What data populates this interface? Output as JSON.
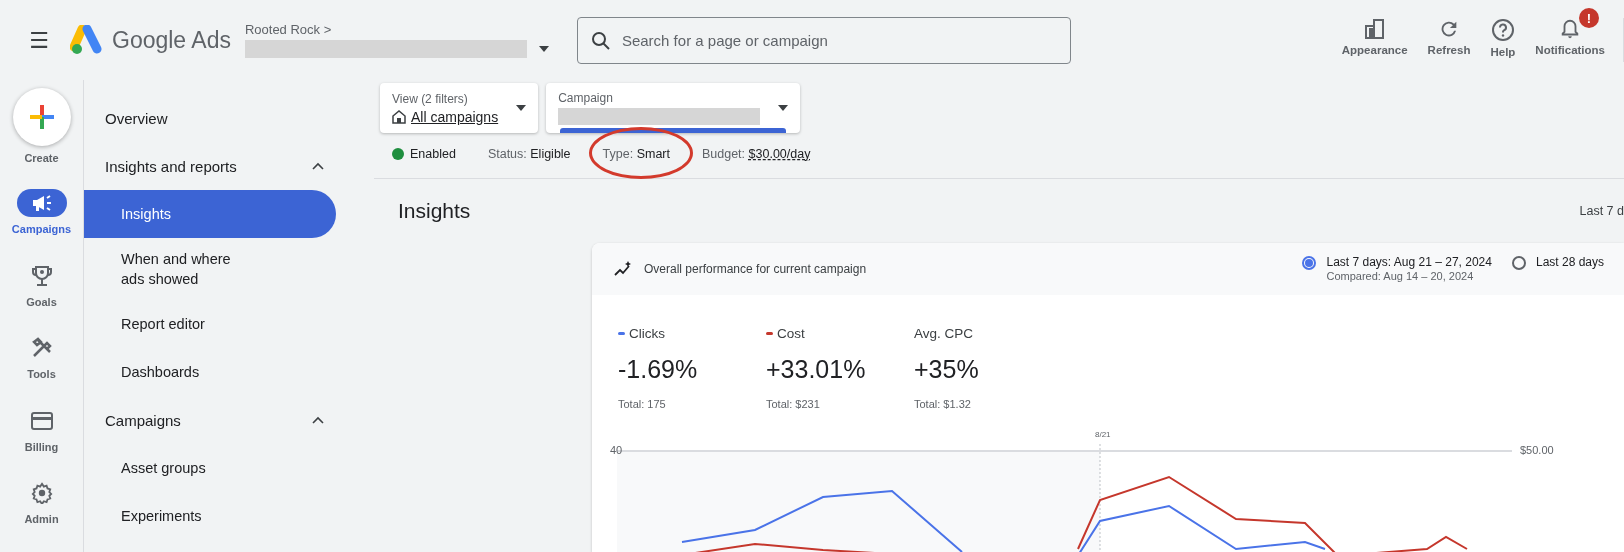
{
  "header": {
    "menu_icon": "☰",
    "logo": "Google Ads",
    "account": "Rooted Rock",
    "account_chevron": ">",
    "search": {
      "placeholder": "Search for a page or campaign"
    },
    "actions": [
      {
        "kind": "appearance",
        "label": "Appearance"
      },
      {
        "kind": "refresh",
        "label": "Refresh"
      },
      {
        "kind": "help",
        "label": "Help"
      },
      {
        "kind": "notifications",
        "label": "Notifications",
        "badge": "!"
      }
    ]
  },
  "rail": {
    "items": [
      {
        "kind": "create",
        "label": "Create",
        "selected": false
      },
      {
        "kind": "campaigns",
        "label": "Campaigns",
        "selected": true
      },
      {
        "kind": "goals",
        "label": "Goals",
        "selected": false
      },
      {
        "kind": "tools",
        "label": "Tools",
        "selected": false
      },
      {
        "kind": "billing",
        "label": "Billing",
        "selected": false
      },
      {
        "kind": "admin",
        "label": "Admin",
        "selected": false
      }
    ]
  },
  "sidebar": {
    "items": [
      {
        "label": "Overview",
        "kind": "link",
        "selected": false
      },
      {
        "label": "Insights and reports",
        "kind": "group",
        "expanded": true,
        "children": [
          {
            "label": "Insights",
            "selected": true
          },
          {
            "label": "When and where ads showed",
            "selected": false
          },
          {
            "label": "Report editor",
            "selected": false
          },
          {
            "label": "Dashboards",
            "selected": false
          }
        ]
      },
      {
        "label": "Campaigns",
        "kind": "group",
        "expanded": true,
        "children": [
          {
            "label": "Asset groups",
            "selected": false
          },
          {
            "label": "Experiments",
            "selected": false
          }
        ]
      }
    ]
  },
  "filters": {
    "view": {
      "label": "View (2 filters)",
      "value": "All campaigns"
    },
    "campaign": {
      "label": "Campaign",
      "focused": true
    }
  },
  "status": [
    {
      "kind": "dot",
      "text": "Enabled",
      "color": "#1e8e3e",
      "annotated": false
    },
    {
      "kind": "pair",
      "label": "Status:",
      "value": "Eligible",
      "annotated": false
    },
    {
      "kind": "pair",
      "label": "Type:",
      "value": "Smart",
      "annotated": true
    },
    {
      "kind": "link",
      "label": "Budget:",
      "value": "$30.00/day",
      "annotated": false
    }
  ],
  "page": {
    "title": "Insights",
    "range": "Last 7 d"
  },
  "card": {
    "title": "Overall performance for current campaign",
    "ranges": [
      {
        "label": "Last 7 days: Aug 21 – 27, 2024",
        "sublabel": "Compared: Aug 14 – 20, 2024",
        "selected": true
      },
      {
        "label": "Last 28 days",
        "selected": false
      }
    ],
    "metrics": [
      {
        "name": "Clicks",
        "color": "#4a73e8",
        "change": "-1.69%",
        "total": "Total: 175"
      },
      {
        "name": "Cost",
        "color": "#c5372c",
        "change": "+33.01%",
        "total": "Total: $231"
      },
      {
        "name": "Avg. CPC",
        "change": "+35%",
        "total": "Total: $1.32"
      }
    ],
    "chart": {
      "left_tick": "40",
      "right_tick": "$50.00",
      "marker": "8/21"
    }
  }
}
